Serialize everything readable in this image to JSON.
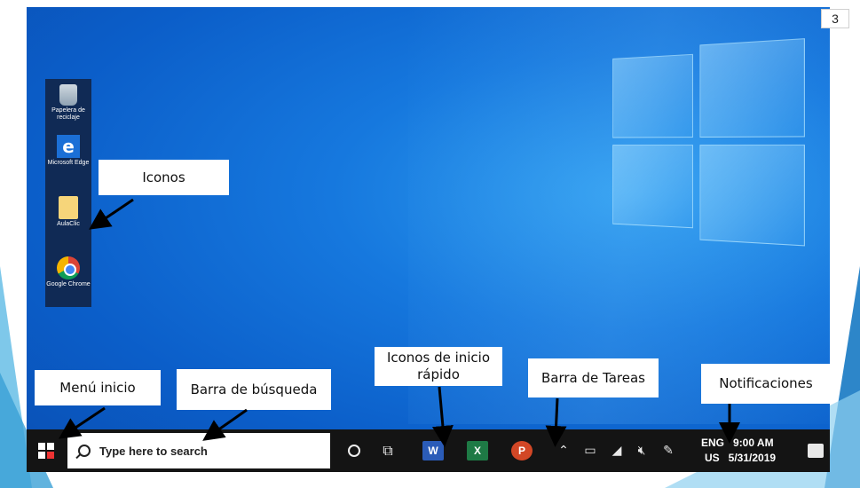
{
  "slide": {
    "page_number": "3"
  },
  "desktop_icons": [
    {
      "label": "Papelera de reciclaje",
      "icon": "recycle-bin-icon"
    },
    {
      "label": "Microsoft Edge",
      "icon": "edge-icon"
    },
    {
      "label": "AulaClic",
      "icon": "folder-icon"
    },
    {
      "label": "Google Chrome",
      "icon": "chrome-icon"
    }
  ],
  "callouts": {
    "iconos": "Iconos",
    "menu_inicio": "Menú inicio",
    "barra_busqueda": "Barra de búsqueda",
    "inicio_rapido": "Iconos de inicio rápido",
    "barra_tareas": "Barra de Tareas",
    "notificaciones": "Notificaciones"
  },
  "taskbar": {
    "search_placeholder": "Type here to search",
    "pinned_apps": [
      {
        "name": "Word",
        "letter": "W",
        "color": "#2b5cb8"
      },
      {
        "name": "Excel",
        "letter": "X",
        "color": "#1e7a45"
      },
      {
        "name": "PowerPoint",
        "letter": "P",
        "color": "#d24726"
      }
    ],
    "language_top": "ENG",
    "language_bottom": "US",
    "time": "9:00 AM",
    "date": "5/31/2019"
  },
  "colors": {
    "desktop_blue": "#0b5ec9",
    "taskbar": "#141414",
    "callout_bg": "#ffffff"
  }
}
